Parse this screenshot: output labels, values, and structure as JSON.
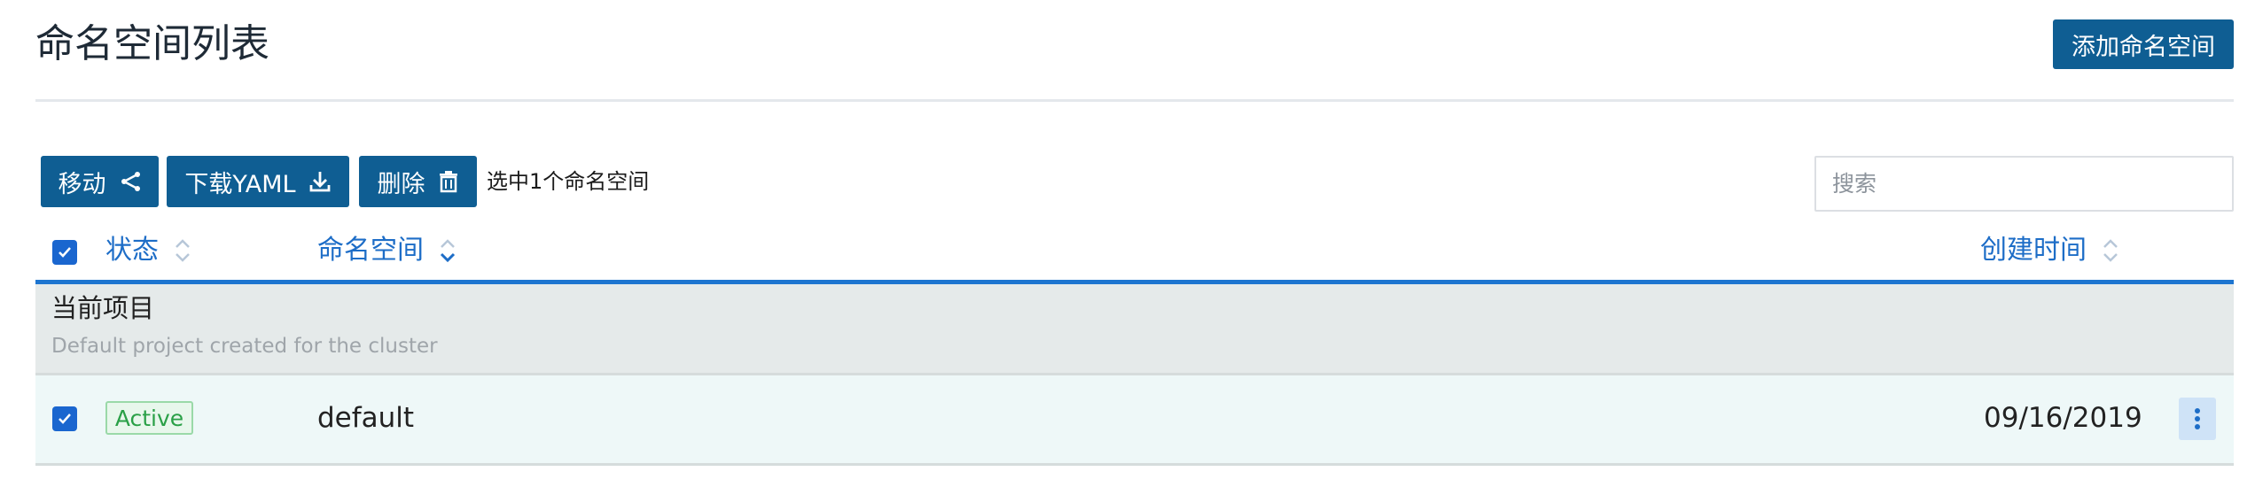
{
  "header": {
    "title": "命名空间列表",
    "add_button": "添加命名空间"
  },
  "toolbar": {
    "move_label": "移动",
    "download_label": "下载YAML",
    "delete_label": "删除",
    "selection_text": "选中1个命名空间",
    "search_placeholder": "搜索"
  },
  "table": {
    "columns": {
      "status": "状态",
      "namespace": "命名空间",
      "created": "创建时间"
    },
    "group": {
      "name": "当前项目",
      "description": "Default project created for the cluster"
    },
    "rows": [
      {
        "status": "Active",
        "name": "default",
        "created": "09/16/2019",
        "checked": true
      }
    ]
  },
  "colors": {
    "primary": "#0f5e93",
    "link": "#1d6dc7",
    "checkbox": "#1a66cf",
    "active_text": "#2aa047",
    "active_bg": "#e8f7ec"
  },
  "icons": [
    "share-icon",
    "download-icon",
    "trash-icon",
    "check-icon",
    "sort-icon",
    "kebab-icon"
  ]
}
